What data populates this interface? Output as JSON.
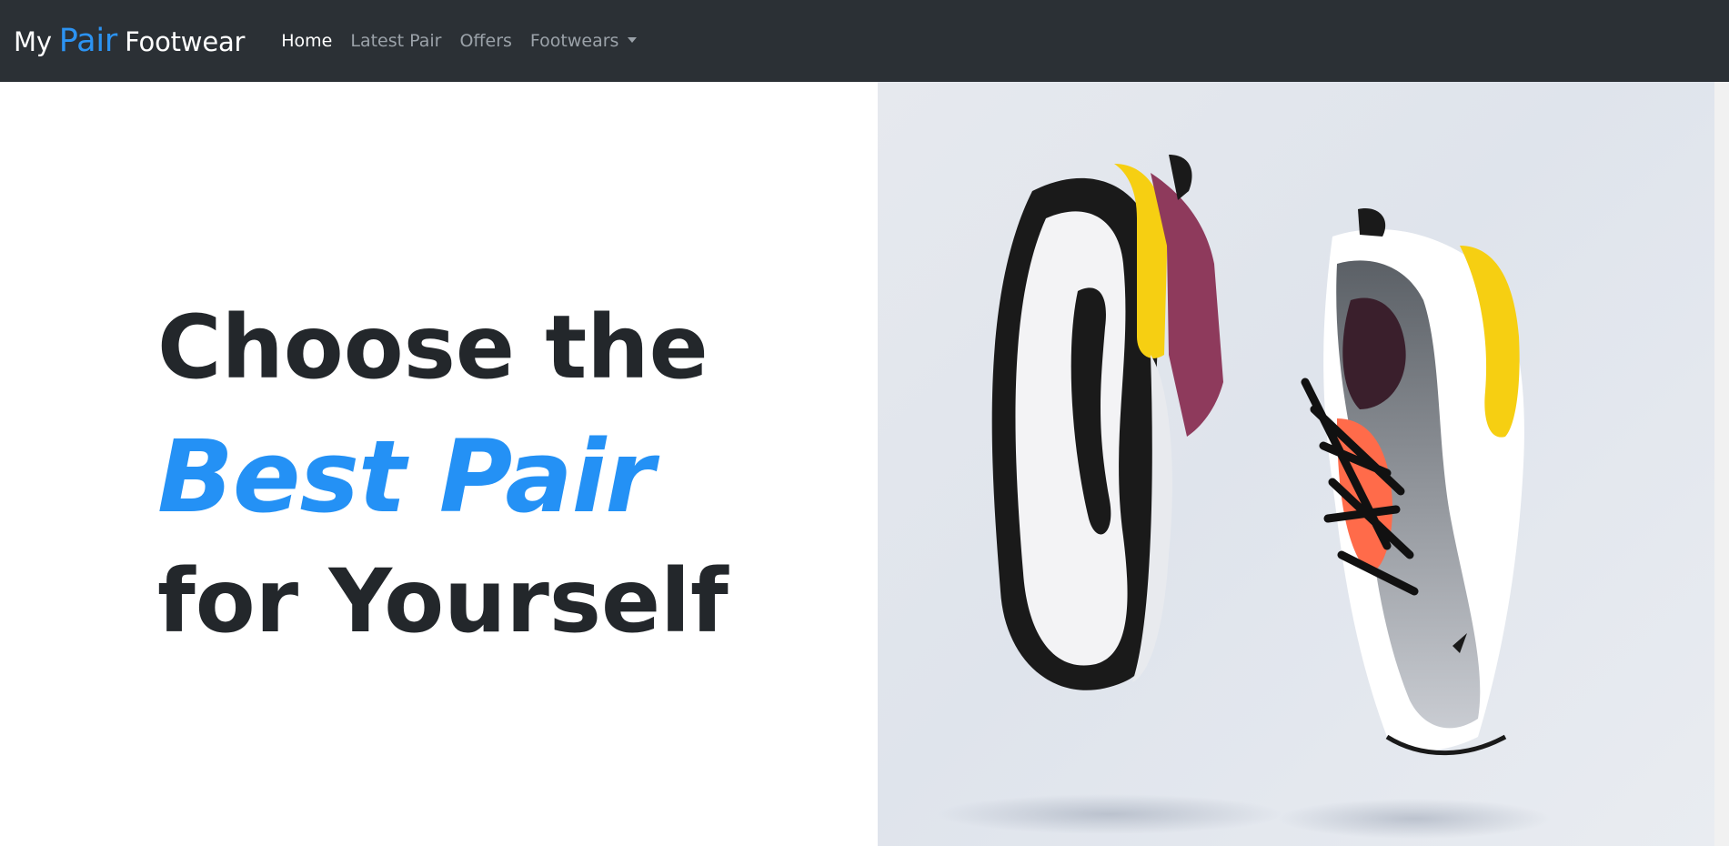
{
  "navbar": {
    "brand_prefix": "My",
    "brand_accent": "Pair",
    "brand_suffix": "Footwear",
    "links": [
      {
        "label": "Home",
        "active": true
      },
      {
        "label": "Latest Pair",
        "active": false
      },
      {
        "label": "Offers",
        "active": false
      },
      {
        "label": "Footwears",
        "active": false,
        "dropdown": true
      }
    ]
  },
  "hero": {
    "line1": "Choose the",
    "line2": "Best Pair",
    "line3": "for Yourself",
    "image": "floating-sneakers-photo"
  },
  "colors": {
    "navbar_bg": "#2b3035",
    "accent": "#2491f5",
    "headline": "#23272b",
    "sole_yellow": "#f6cf12"
  }
}
